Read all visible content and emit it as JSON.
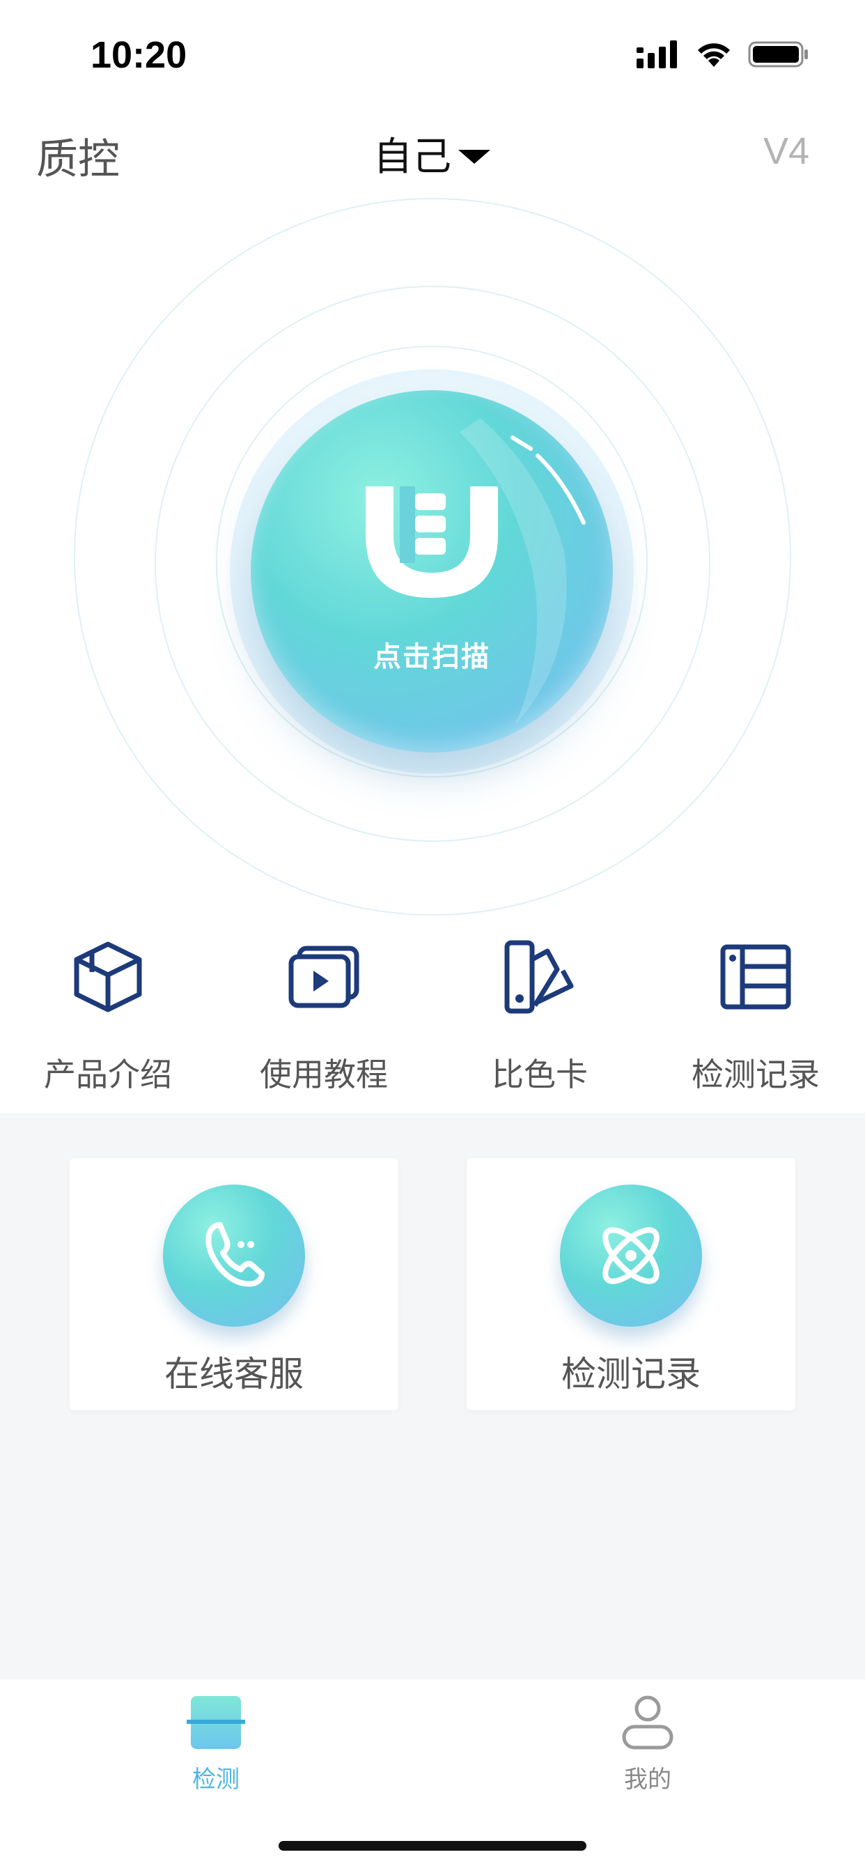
{
  "status_bar": {
    "time": "10:20",
    "icons": [
      "signal-icon",
      "wifi-icon",
      "battery-icon"
    ]
  },
  "nav": {
    "left_title": "质控",
    "center_selector": "自己",
    "right_version": "V4"
  },
  "scan": {
    "label": "点击扫描"
  },
  "quick_links": [
    {
      "label": "产品介绍",
      "icon": "box-icon"
    },
    {
      "label": "使用教程",
      "icon": "video-icon"
    },
    {
      "label": "比色卡",
      "icon": "color-card-icon"
    },
    {
      "label": "检测记录",
      "icon": "list-icon"
    }
  ],
  "cards": [
    {
      "label": "在线客服",
      "icon": "phone-icon"
    },
    {
      "label": "检测记录",
      "icon": "atom-icon"
    }
  ],
  "tab_bar": {
    "tabs": [
      {
        "label": "检测",
        "icon": "scan-tab-icon",
        "active": true
      },
      {
        "label": "我的",
        "icon": "user-icon",
        "active": false
      }
    ]
  },
  "colors": {
    "accent": "#4fb6e0",
    "icon_dark_blue": "#1d3a7a",
    "inactive": "#888888"
  }
}
